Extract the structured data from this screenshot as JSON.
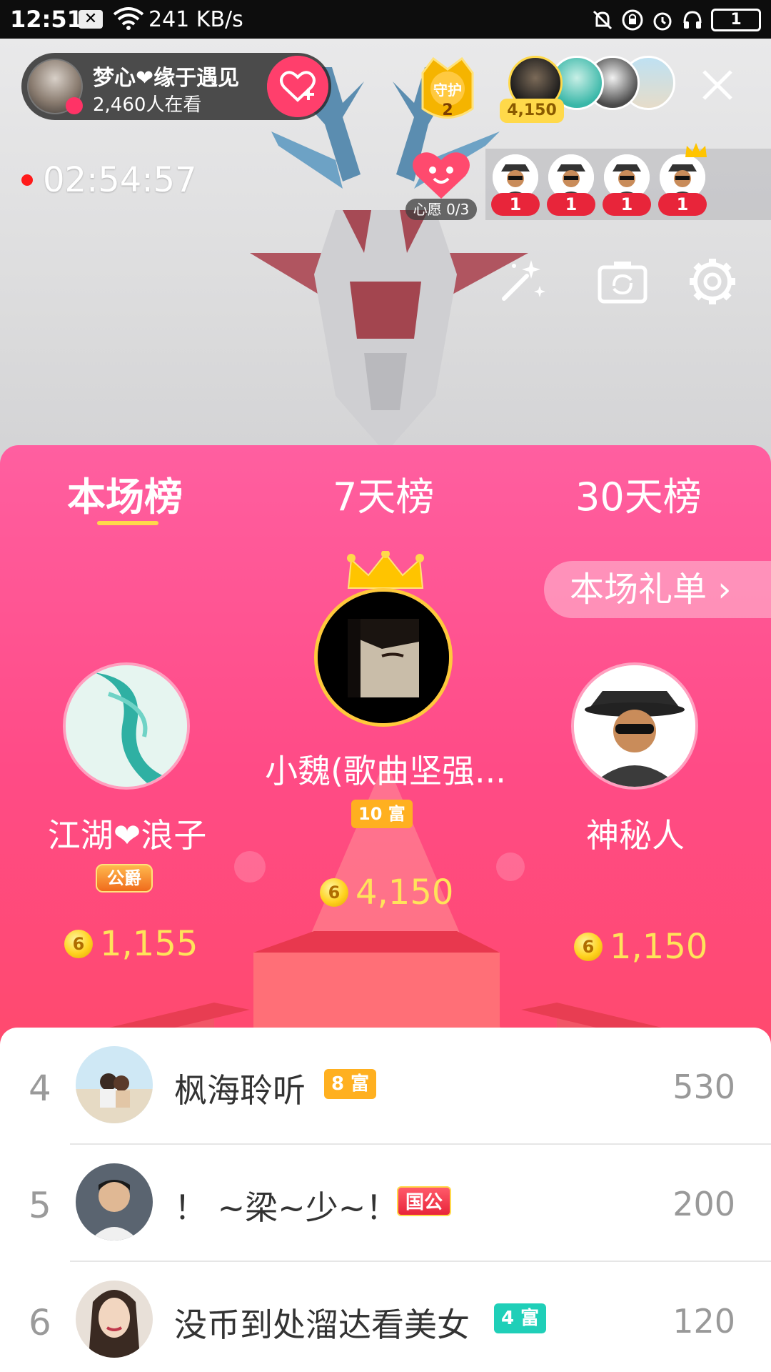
{
  "status_bar": {
    "time": "12:51",
    "speed": "241 KB/s",
    "battery": "1"
  },
  "live": {
    "host": {
      "name": "梦心❤缘于遇见",
      "viewers": "2,460人在看"
    },
    "guard": {
      "label": "守护",
      "count": "2"
    },
    "top_fan_score": "4,150",
    "timer": "02:54:57",
    "wish": {
      "label": "心愿 0/3"
    },
    "viewer_counts": [
      "1",
      "1",
      "1",
      "1"
    ]
  },
  "tabs": [
    "本场榜",
    "7天榜",
    "30天榜"
  ],
  "gift_list_button": "本场礼单 ›",
  "podium": {
    "first": {
      "name": "小魏(歌曲坚强...",
      "badge": "10 富",
      "coins": "4,150"
    },
    "second": {
      "name": "江湖❤浪子",
      "badge": "公爵",
      "coins": "1,155"
    },
    "third": {
      "name": "神秘人",
      "coins": "1,150"
    }
  },
  "ranking_list": [
    {
      "rank": "4",
      "name": "枫海聆听",
      "badge": "8 富",
      "value": "530"
    },
    {
      "rank": "5",
      "name": "！ ~梁~少~！",
      "badge": "国公",
      "value": "200"
    },
    {
      "rank": "6",
      "name": "没币到处溜达看美女",
      "badge": "4 富",
      "value": "120"
    }
  ],
  "colors": {
    "panel_top": "#ff5fa0",
    "panel_bottom": "#ff5a5a",
    "coin_text": "#ffe35a",
    "rich_badge_orange": "#ffb020",
    "rich_badge_teal": "#1fcfb8"
  }
}
